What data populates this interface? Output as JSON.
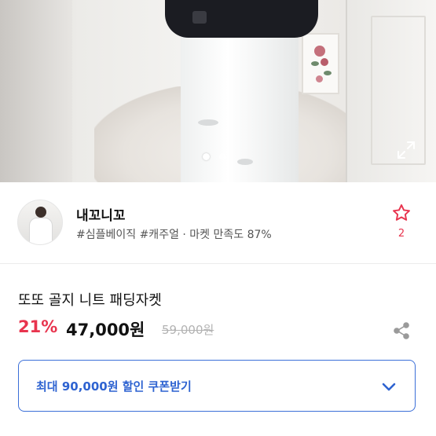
{
  "gallery": {
    "image_description_icon": "product-photo",
    "dots": [
      true,
      false
    ],
    "expand_icon": "expand-icon"
  },
  "seller": {
    "name": "내꼬니꼬",
    "tags": "#심플베이직 #캐주얼 · 마켓 만족도 87%",
    "wish_count": "2",
    "wish_icon": "star-outline-icon"
  },
  "product": {
    "name": "또또 골지 니트 패딩자켓",
    "discount": "21%",
    "price": "47,000원",
    "original_price": "59,000원",
    "share_icon": "share-icon"
  },
  "coupon": {
    "label": "최대 90,000원 할인 쿠폰받기",
    "chevron_icon": "chevron-down-icon"
  },
  "colors": {
    "accent_red": "#e8344e",
    "coupon_blue": "#2e63d1"
  }
}
